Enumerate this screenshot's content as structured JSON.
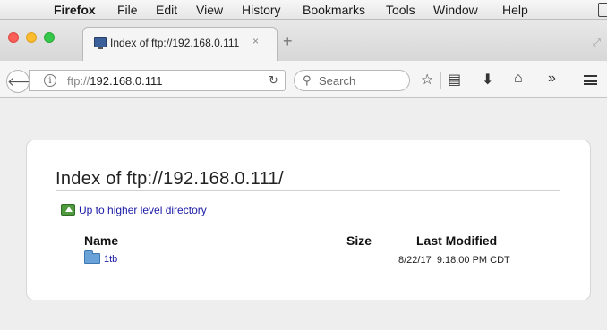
{
  "menubar": {
    "app": "Firefox",
    "items": [
      "File",
      "Edit",
      "View",
      "History",
      "Bookmarks",
      "Tools",
      "Window",
      "Help"
    ]
  },
  "tab": {
    "title": "Index of ftp://192.168.0.111",
    "close_glyph": "×",
    "new_tab_glyph": "+"
  },
  "navbar": {
    "url_scheme": "ftp://",
    "url_host": "192.168.0.111",
    "search_placeholder": "Search"
  },
  "page": {
    "heading": "Index of ftp://192.168.0.111/",
    "up_link": "Up to higher level directory",
    "columns": {
      "name": "Name",
      "size": "Size",
      "modified": "Last Modified"
    },
    "rows": [
      {
        "name": "1tb",
        "size": "",
        "date": "8/22/17",
        "time": "9:18:00 PM CDT"
      }
    ]
  }
}
